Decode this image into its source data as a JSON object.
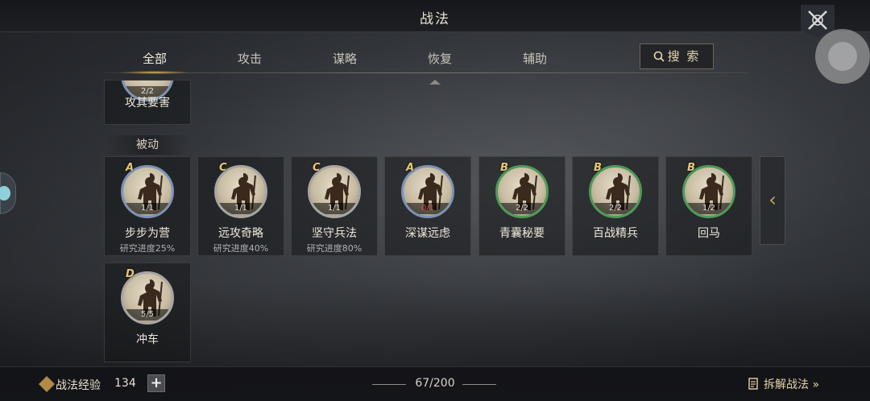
{
  "title": "战法",
  "tabs": [
    "全部",
    "攻击",
    "谋略",
    "恢复",
    "辅助"
  ],
  "active_tab": "全部",
  "search_label": "搜 索",
  "active_section": {
    "partial_card": {
      "name": "攻其要害",
      "level": "2/2"
    }
  },
  "passive_section_label": "被动",
  "passive_cards": [
    {
      "name": "步步为营",
      "grade": "A",
      "level": "1/1",
      "progress": "研究进度25%"
    },
    {
      "name": "远攻奇略",
      "grade": "C",
      "level": "1/1",
      "progress": "研究进度40%"
    },
    {
      "name": "坚守兵法",
      "grade": "C",
      "level": "1/1",
      "progress": "研究进度80%"
    },
    {
      "name": "深谋远虑",
      "grade": "A",
      "level": "0/1",
      "progress": ""
    },
    {
      "name": "青囊秘要",
      "grade": "B",
      "level": "2/2",
      "progress": ""
    },
    {
      "name": "百战精兵",
      "grade": "B",
      "level": "2/2",
      "progress": ""
    },
    {
      "name": "回马",
      "grade": "B",
      "level": "1/2",
      "progress": ""
    },
    {
      "name": "冲车",
      "grade": "D",
      "level": "5/5",
      "progress": ""
    }
  ],
  "side_arrow": "‹",
  "bottom": {
    "exp_label": "战法经验",
    "exp_value": "134",
    "plus": "+",
    "capacity": "67/200",
    "decompose_label": "拆解战法 »"
  },
  "colors": {
    "accent_gold": "#e3b24a",
    "grade_A_ring": "#7b94b4",
    "grade_B_ring": "#4f9a58",
    "grade_C_ring": "#a7a6a2",
    "level_zero": "#e0584c"
  }
}
